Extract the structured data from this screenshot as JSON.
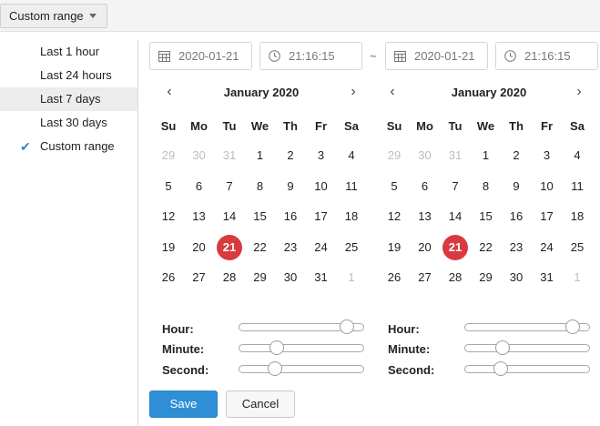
{
  "range_dropdown": {
    "label": "Custom range"
  },
  "presets": [
    {
      "label": "Last 1 hour",
      "active": false,
      "checked": false
    },
    {
      "label": "Last 24 hours",
      "active": false,
      "checked": false
    },
    {
      "label": "Last 7 days",
      "active": true,
      "checked": false
    },
    {
      "label": "Last 30 days",
      "active": false,
      "checked": false
    },
    {
      "label": "Custom range",
      "active": false,
      "checked": true
    }
  ],
  "start": {
    "date": "2020-01-21",
    "time": "21:16:15"
  },
  "separator": "~",
  "end": {
    "date": "2020-01-21",
    "time": "21:16:15"
  },
  "weekdays": [
    "Su",
    "Mo",
    "Tu",
    "We",
    "Th",
    "Fr",
    "Sa"
  ],
  "calendars": [
    {
      "month_label": "January 2020",
      "prev": "‹",
      "next": "›",
      "selected_day": 21,
      "weeks": [
        [
          {
            "d": "29",
            "m": true
          },
          {
            "d": "30",
            "m": true
          },
          {
            "d": "31",
            "m": true
          },
          {
            "d": "1"
          },
          {
            "d": "2"
          },
          {
            "d": "3"
          },
          {
            "d": "4"
          }
        ],
        [
          {
            "d": "5"
          },
          {
            "d": "6"
          },
          {
            "d": "7"
          },
          {
            "d": "8"
          },
          {
            "d": "9"
          },
          {
            "d": "10"
          },
          {
            "d": "11"
          }
        ],
        [
          {
            "d": "12"
          },
          {
            "d": "13"
          },
          {
            "d": "14"
          },
          {
            "d": "15"
          },
          {
            "d": "16"
          },
          {
            "d": "17"
          },
          {
            "d": "18"
          }
        ],
        [
          {
            "d": "19"
          },
          {
            "d": "20"
          },
          {
            "d": "21",
            "s": true
          },
          {
            "d": "22"
          },
          {
            "d": "23"
          },
          {
            "d": "24"
          },
          {
            "d": "25"
          }
        ],
        [
          {
            "d": "26"
          },
          {
            "d": "27"
          },
          {
            "d": "28"
          },
          {
            "d": "29"
          },
          {
            "d": "30"
          },
          {
            "d": "31"
          },
          {
            "d": "1",
            "m": true
          }
        ]
      ],
      "time_labels": {
        "hour": "Hour:",
        "minute": "Minute:",
        "second": "Second:"
      },
      "time_values": {
        "hour": 21,
        "minute": 16,
        "second": 15
      }
    },
    {
      "month_label": "January 2020",
      "prev": "‹",
      "next": "›",
      "selected_day": 21,
      "weeks": [
        [
          {
            "d": "29",
            "m": true
          },
          {
            "d": "30",
            "m": true
          },
          {
            "d": "31",
            "m": true
          },
          {
            "d": "1"
          },
          {
            "d": "2"
          },
          {
            "d": "3"
          },
          {
            "d": "4"
          }
        ],
        [
          {
            "d": "5"
          },
          {
            "d": "6"
          },
          {
            "d": "7"
          },
          {
            "d": "8"
          },
          {
            "d": "9"
          },
          {
            "d": "10"
          },
          {
            "d": "11"
          }
        ],
        [
          {
            "d": "12"
          },
          {
            "d": "13"
          },
          {
            "d": "14"
          },
          {
            "d": "15"
          },
          {
            "d": "16"
          },
          {
            "d": "17"
          },
          {
            "d": "18"
          }
        ],
        [
          {
            "d": "19"
          },
          {
            "d": "20"
          },
          {
            "d": "21",
            "s": true
          },
          {
            "d": "22"
          },
          {
            "d": "23"
          },
          {
            "d": "24"
          },
          {
            "d": "25"
          }
        ],
        [
          {
            "d": "26"
          },
          {
            "d": "27"
          },
          {
            "d": "28"
          },
          {
            "d": "29"
          },
          {
            "d": "30"
          },
          {
            "d": "31"
          },
          {
            "d": "1",
            "m": true
          }
        ]
      ],
      "time_labels": {
        "hour": "Hour:",
        "minute": "Minute:",
        "second": "Second:"
      },
      "time_values": {
        "hour": 21,
        "minute": 16,
        "second": 15
      }
    }
  ],
  "actions": {
    "save": "Save",
    "cancel": "Cancel"
  },
  "colors": {
    "accent": "#2f8fd6",
    "selected_day": "#d83a3f",
    "check": "#3a86c8"
  },
  "icons": {
    "date": "calendar-icon",
    "time": "clock-icon",
    "check": "checkmark-icon",
    "dropdown": "caret-down-icon"
  }
}
